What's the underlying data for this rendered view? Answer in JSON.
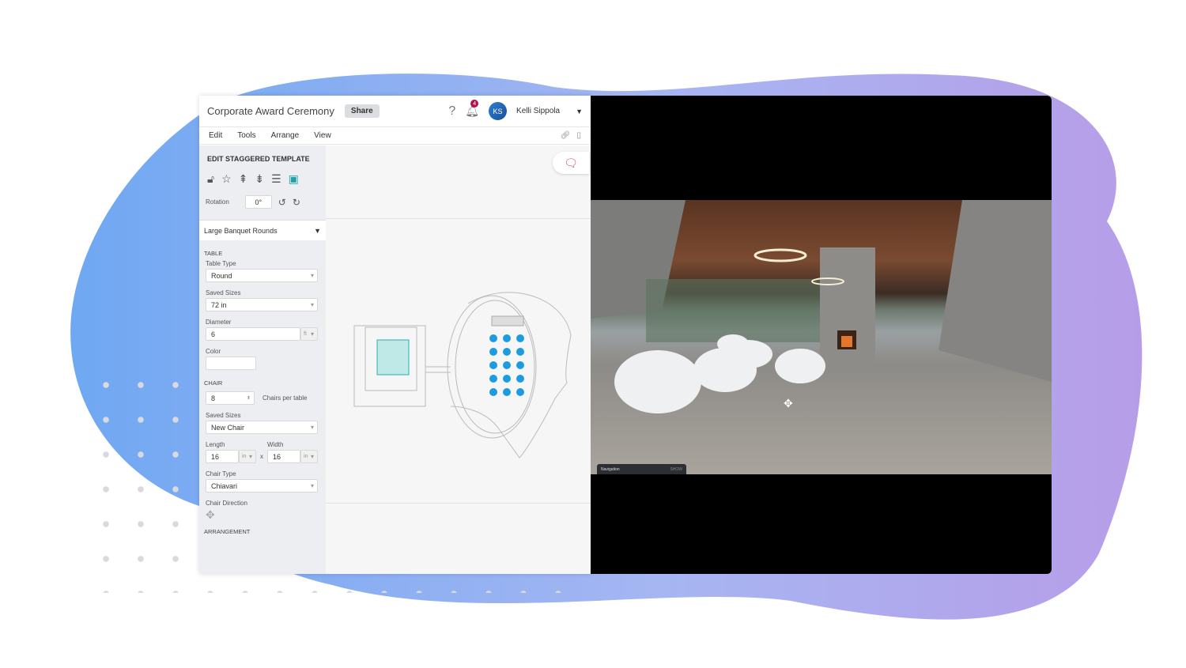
{
  "header": {
    "title": "Corporate Award Ceremony",
    "share_label": "Share",
    "notification_count": "4",
    "user_initials": "KS",
    "user_name": "Kelli Sippola"
  },
  "menu": [
    "Edit",
    "Tools",
    "Arrange",
    "View"
  ],
  "panel": {
    "heading": "EDIT STAGGERED TEMPLATE",
    "rotation_label": "Rotation",
    "rotation_value": "0°",
    "template": "Large Banquet Rounds",
    "table_section": "TABLE",
    "table_type_label": "Table Type",
    "table_type": "Round",
    "saved_sizes_label": "Saved Sizes",
    "saved_size": "72 in",
    "diameter_label": "Diameter",
    "diameter": "6",
    "diameter_unit": "ft",
    "color_label": "Color",
    "chair_section": "CHAIR",
    "chairs": "8",
    "chairs_per_table": "Chairs per table",
    "chair_saved_sizes_label": "Saved Sizes",
    "chair_saved_size": "New Chair",
    "length_label": "Length",
    "length": "16",
    "length_unit": "in",
    "x": "x",
    "width_label": "Width",
    "width": "16",
    "width_unit": "in",
    "chair_type_label": "Chair Type",
    "chair_type": "Chiavari",
    "chair_direction_label": "Chair Direction",
    "arrangement_section": "ARRANGEMENT"
  },
  "viewer": {
    "nav_label": "Navigation",
    "nav_toggle": "SHOW"
  },
  "colors": {
    "accent": "#1e9be0",
    "notification": "#b0124f",
    "chat": "#c2408a"
  }
}
